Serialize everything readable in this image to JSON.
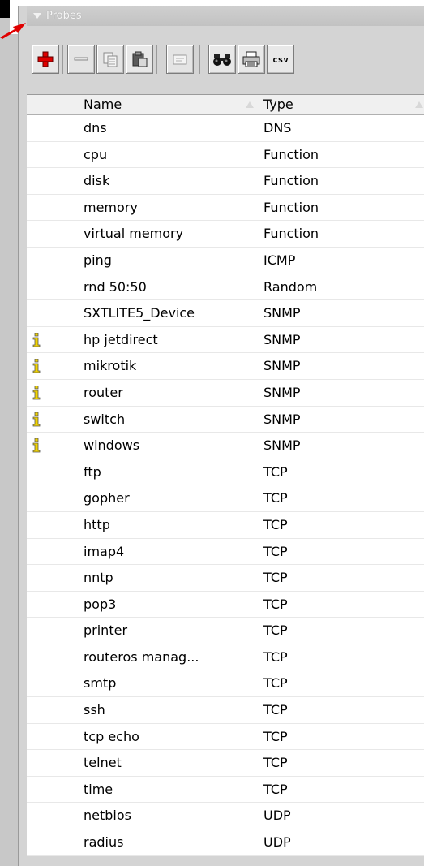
{
  "panel": {
    "title": "Probes"
  },
  "toolbar": {
    "add": "add-icon",
    "remove": "remove-icon",
    "copy": "copy-icon",
    "paste": "paste-icon",
    "edit": "edit-icon",
    "find": "find-icon",
    "print": "print-icon",
    "csv_label": "csv"
  },
  "columns": {
    "name": "Name",
    "type": "Type"
  },
  "rows": [
    {
      "name": "dns",
      "type": "DNS",
      "info": false
    },
    {
      "name": "cpu",
      "type": "Function",
      "info": false
    },
    {
      "name": "disk",
      "type": "Function",
      "info": false
    },
    {
      "name": "memory",
      "type": "Function",
      "info": false
    },
    {
      "name": "virtual memory",
      "type": "Function",
      "info": false
    },
    {
      "name": "ping",
      "type": "ICMP",
      "info": false
    },
    {
      "name": "rnd 50:50",
      "type": "Random",
      "info": false
    },
    {
      "name": "SXTLITE5_Device",
      "type": "SNMP",
      "info": false
    },
    {
      "name": "hp jetdirect",
      "type": "SNMP",
      "info": true
    },
    {
      "name": "mikrotik",
      "type": "SNMP",
      "info": true
    },
    {
      "name": "router",
      "type": "SNMP",
      "info": true
    },
    {
      "name": "switch",
      "type": "SNMP",
      "info": true
    },
    {
      "name": "windows",
      "type": "SNMP",
      "info": true
    },
    {
      "name": "ftp",
      "type": "TCP",
      "info": false
    },
    {
      "name": "gopher",
      "type": "TCP",
      "info": false
    },
    {
      "name": "http",
      "type": "TCP",
      "info": false
    },
    {
      "name": "imap4",
      "type": "TCP",
      "info": false
    },
    {
      "name": "nntp",
      "type": "TCP",
      "info": false
    },
    {
      "name": "pop3",
      "type": "TCP",
      "info": false
    },
    {
      "name": "printer",
      "type": "TCP",
      "info": false
    },
    {
      "name": "routeros manag...",
      "type": "TCP",
      "info": false
    },
    {
      "name": "smtp",
      "type": "TCP",
      "info": false
    },
    {
      "name": "ssh",
      "type": "TCP",
      "info": false
    },
    {
      "name": "tcp echo",
      "type": "TCP",
      "info": false
    },
    {
      "name": "telnet",
      "type": "TCP",
      "info": false
    },
    {
      "name": "time",
      "type": "TCP",
      "info": false
    },
    {
      "name": "netbios",
      "type": "UDP",
      "info": false
    },
    {
      "name": "radius",
      "type": "UDP",
      "info": false
    }
  ],
  "colors": {
    "accent_red": "#e00000",
    "info_yellow": "#f2d400"
  }
}
